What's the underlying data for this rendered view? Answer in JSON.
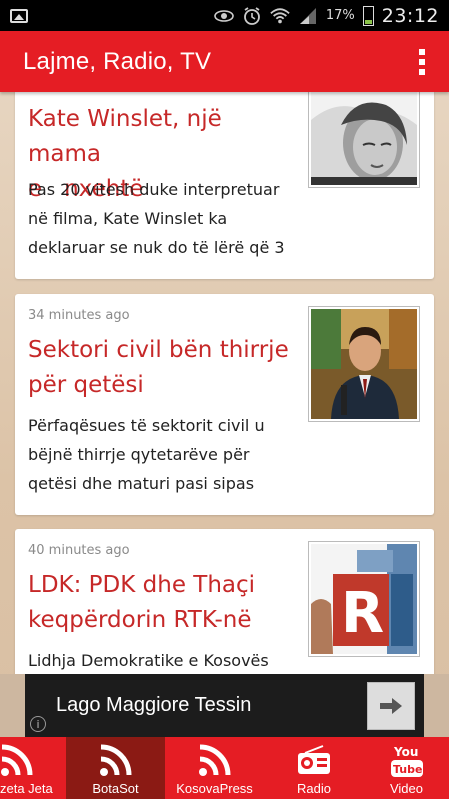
{
  "status_bar": {
    "battery_percent": "17%",
    "time": "23:12"
  },
  "app_bar": {
    "title": "Lajme, Radio, TV"
  },
  "articles": [
    {
      "time": "",
      "headline_line1": "Kate Winslet, një mama",
      "headline_line2": "e   nxehtë",
      "summary_lines": [
        "Pas 20 vitesh duke interpretuar",
        "në filma, Kate Winslet ka",
        "deklaruar se nuk do të lërë që 3"
      ]
    },
    {
      "time": "34 minutes ago",
      "headline_line1": "Sektori civil bën thirrje",
      "headline_line2": "për qetësi",
      "summary_lines": [
        "Përfaqësues të sektorit civil u",
        "bëjnë thirrje qytetarëve për",
        "qetësi dhe maturi pasi sipas"
      ]
    },
    {
      "time": "40 minutes ago",
      "headline_line1": "LDK: PDK dhe Thaçi",
      "headline_line2": "keqpërdorin RTK-në",
      "summary_lines": [
        "Lidhja Demokratike e Kosovës"
      ]
    }
  ],
  "ad": {
    "text": "Lago Maggiore Tessin",
    "info": "i"
  },
  "tabs": [
    {
      "label": "zeta Jeta",
      "icon": "rss-icon",
      "active": false
    },
    {
      "label": "BotaSot",
      "icon": "rss-icon",
      "active": true
    },
    {
      "label": "KosovaPress",
      "icon": "rss-icon",
      "active": false
    },
    {
      "label": "Radio",
      "icon": "radio-icon",
      "active": false
    },
    {
      "label": "Video",
      "icon": "youtube-icon",
      "active": false
    }
  ],
  "colors": {
    "brand_red": "#e51d24",
    "active_tab": "#8b1a14",
    "headline_red": "#c62828"
  }
}
